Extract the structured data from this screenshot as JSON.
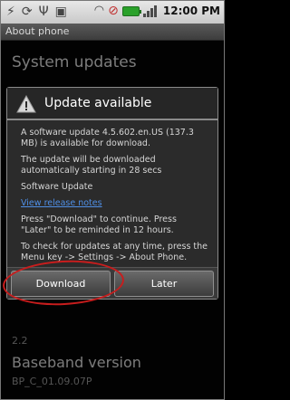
{
  "status_bar": {
    "time": "12:00 PM",
    "icons": [
      "flash-icon",
      "sync-icon",
      "usb-icon",
      "sd-card-icon",
      "wifi-icon",
      "no-sim-icon",
      "battery-icon",
      "signal-icon"
    ]
  },
  "title_bar": {
    "title": "About phone"
  },
  "background": {
    "system_updates": "System updates",
    "android_version_value": "2.2",
    "baseband_title": "Baseband version",
    "baseband_value": "BP_C_01.09.07P"
  },
  "dialog": {
    "title": "Update available",
    "icon": "warning-icon",
    "paragraphs": [
      "A software update 4.5.602.en.US (137.3 MB) is available for download.",
      "The update will be downloaded automatically starting in 28 secs",
      "Software Update"
    ],
    "link": "View release notes",
    "instructions": "Press \"Download\" to continue. Press \"Later\" to be reminded in 12 hours.",
    "menu_hint": "To check for updates at any time, press the Menu key -> Settings -> About Phone.",
    "buttons": {
      "download": "Download",
      "later": "Later"
    }
  },
  "annotation": {
    "color": "#c81d1d"
  }
}
